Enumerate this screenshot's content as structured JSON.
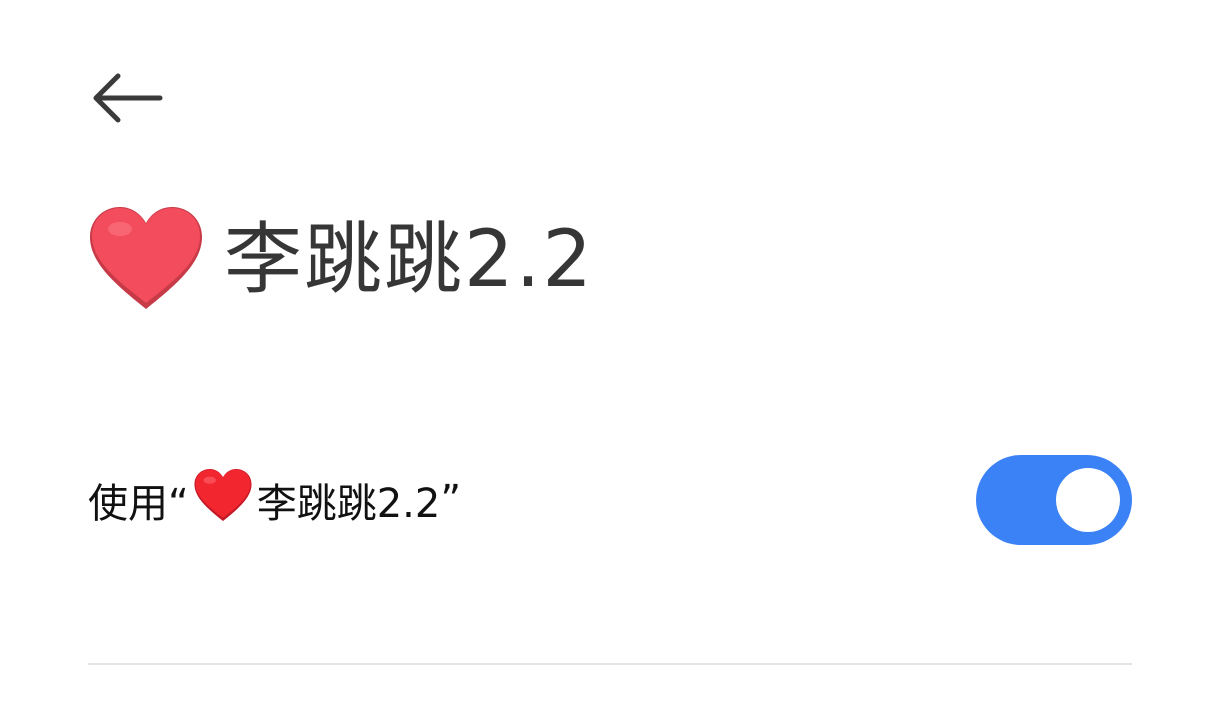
{
  "header": {
    "back_icon": "arrow-left-icon"
  },
  "title": {
    "icon": "red-heart-icon",
    "text": "李跳跳2.2"
  },
  "setting": {
    "label_prefix": "使用“",
    "label_icon": "red-heart-icon",
    "label_name": "李跳跳2.2",
    "label_suffix": "”",
    "toggle_state": "on"
  },
  "colors": {
    "toggle_on": "#3B82F6",
    "heart": "#F25060",
    "text_primary": "#363636",
    "divider": "#E4E4E4"
  }
}
